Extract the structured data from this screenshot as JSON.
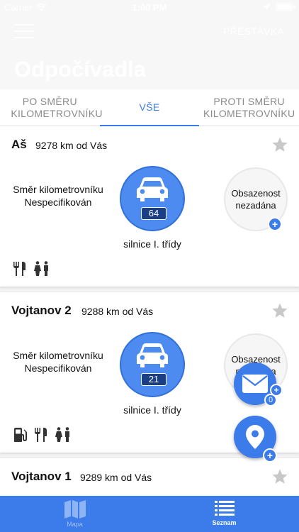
{
  "status_bar": {
    "carrier": "Carrier",
    "time": "1:00 PM"
  },
  "header": {
    "pause_button": "PŘESTÁVKA",
    "title": "Odpočívadla"
  },
  "tabs": [
    {
      "label": "PO SMĚRU KILOMETROVNÍKU",
      "active": false
    },
    {
      "label": "VŠE",
      "active": true
    },
    {
      "label": "PROTI SMĚRU KILOMETROVNÍKU",
      "active": false
    }
  ],
  "cards": [
    {
      "name": "Aš",
      "distance": "9278 km od Vás",
      "direction": "Směr kilometrovníku Nespecifikován",
      "road_number": "64",
      "road_class": "silnice I. třídy",
      "occupancy": "Obsazenost nezadána",
      "amenities": [
        "restaurant-icon",
        "toilets-icon"
      ]
    },
    {
      "name": "Vojtanov 2",
      "distance": "9288 km od Vás",
      "direction": "Směr kilometrovníku Nespecifikován",
      "road_number": "21",
      "road_class": "silnice I. třídy",
      "occupancy": "Obsazenost nezadána",
      "amenities": [
        "fuel-icon",
        "restaurant-icon",
        "toilets-icon"
      ]
    },
    {
      "name": "Vojtanov 1",
      "distance": "9289 km od Vás"
    }
  ],
  "fab": {
    "messages_count": "0"
  },
  "bottom_tabs": [
    {
      "label": "Mapa",
      "icon": "map-icon",
      "active": false
    },
    {
      "label": "Seznam",
      "icon": "list-icon",
      "active": true
    }
  ],
  "colors": {
    "accent": "#3b7bea",
    "road_circle": "#4d8bf0",
    "road_badge": "#1b3f85"
  }
}
